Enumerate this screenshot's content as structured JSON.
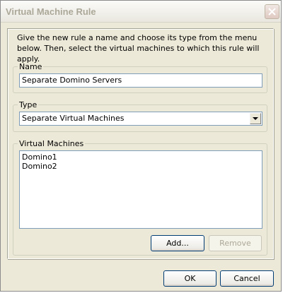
{
  "window": {
    "title": "Virtual Machine Rule"
  },
  "intro_text": "Give the new rule a name and choose its type from the menu below. Then, select the virtual machines to which this rule will apply.",
  "name_group": {
    "label": "Name",
    "value": "Separate Domino Servers"
  },
  "type_group": {
    "label": "Type",
    "selected": "Separate Virtual Machines"
  },
  "vm_group": {
    "label": "Virtual Machines",
    "items": [
      "Domino1",
      "Domino2"
    ],
    "add_label": "Add...",
    "remove_label": "Remove"
  },
  "footer": {
    "ok_label": "OK",
    "cancel_label": "Cancel"
  },
  "colors": {
    "title_text": "#aca899",
    "dialog_bg": "#ece9d8",
    "field_border": "#7f9db9",
    "close_icon": "#ffffff"
  }
}
